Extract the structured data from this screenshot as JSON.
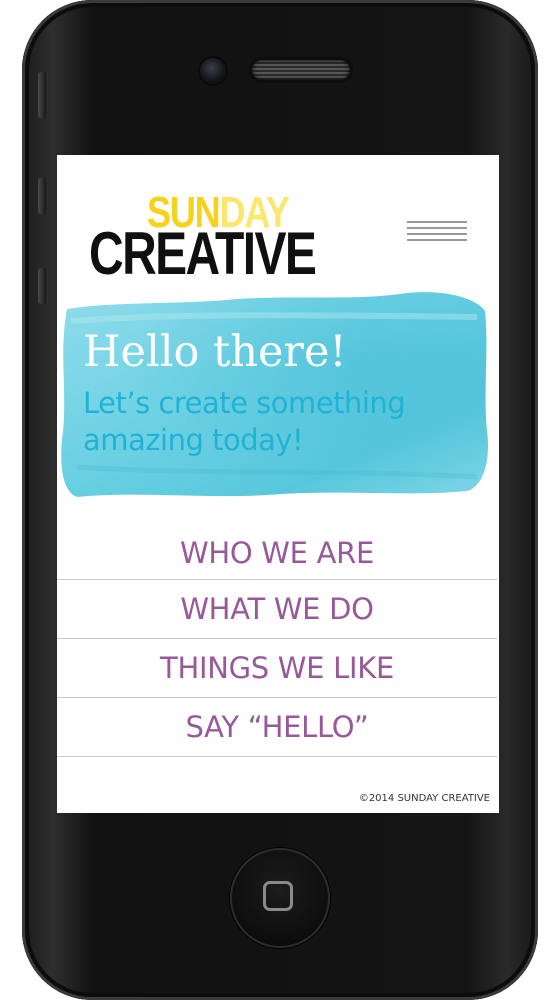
{
  "device": {
    "type": "smartphone",
    "icons": {
      "camera": "front-camera-icon",
      "speaker": "speaker-grille-icon",
      "home": "home-button-icon"
    }
  },
  "header": {
    "logo_top": "SUN",
    "logo_top_light": "DAY",
    "logo_bottom": "CREATIVE",
    "menu_icon": "hamburger-menu-icon"
  },
  "hero": {
    "title": "Hello there!",
    "subtitle": "Let’s create something amazing today!",
    "background": "watercolor-brush-stroke"
  },
  "nav": {
    "items": [
      {
        "label": "WHO WE ARE"
      },
      {
        "label": "WHAT WE DO"
      },
      {
        "label": "THINGS WE LIKE"
      },
      {
        "label": "SAY “HELLO”"
      }
    ]
  },
  "footer": {
    "copyright": "©2014 SUNDAY CREATIVE"
  },
  "colors": {
    "nav_text": "#97599a",
    "hero_subtitle": "#21b2d7",
    "hero_wash": "#5ecde0",
    "logo_yellow": "#f7d21c",
    "logo_dark": "#101010",
    "phone_body": "#141414"
  }
}
